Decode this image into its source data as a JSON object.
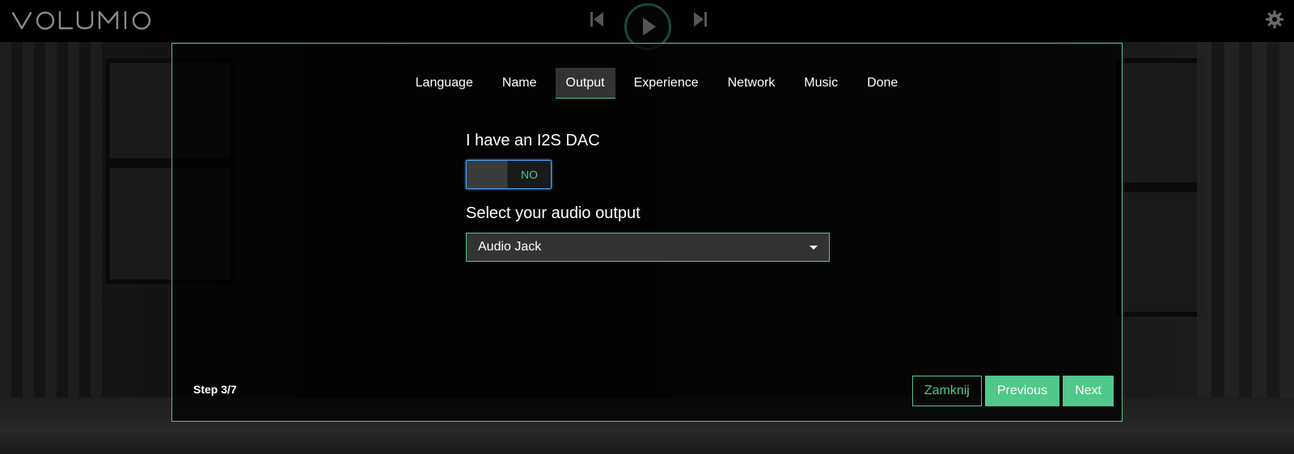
{
  "header": {
    "logo_text": "VOLUMIO",
    "logo_icon": "volumio-logo",
    "transport": {
      "prev_icon": "skip-back-icon",
      "play_icon": "play-icon",
      "next_icon": "skip-forward-icon"
    },
    "settings_icon": "gear-icon"
  },
  "wizard": {
    "tabs": [
      {
        "label": "Language",
        "active": false
      },
      {
        "label": "Name",
        "active": false
      },
      {
        "label": "Output",
        "active": true
      },
      {
        "label": "Experience",
        "active": false
      },
      {
        "label": "Network",
        "active": false
      },
      {
        "label": "Music",
        "active": false
      },
      {
        "label": "Done",
        "active": false
      }
    ],
    "i2s_label": "I have an I2S DAC",
    "i2s_toggle_state": "NO",
    "output_label": "Select your audio output",
    "output_selected": "Audio Jack",
    "step_text": "Step 3/7",
    "buttons": {
      "close": "Zamknij",
      "previous": "Previous",
      "next": "Next"
    }
  },
  "colors": {
    "accent": "#4fc88a",
    "focus": "#4aa6ff",
    "background": "#000000"
  }
}
